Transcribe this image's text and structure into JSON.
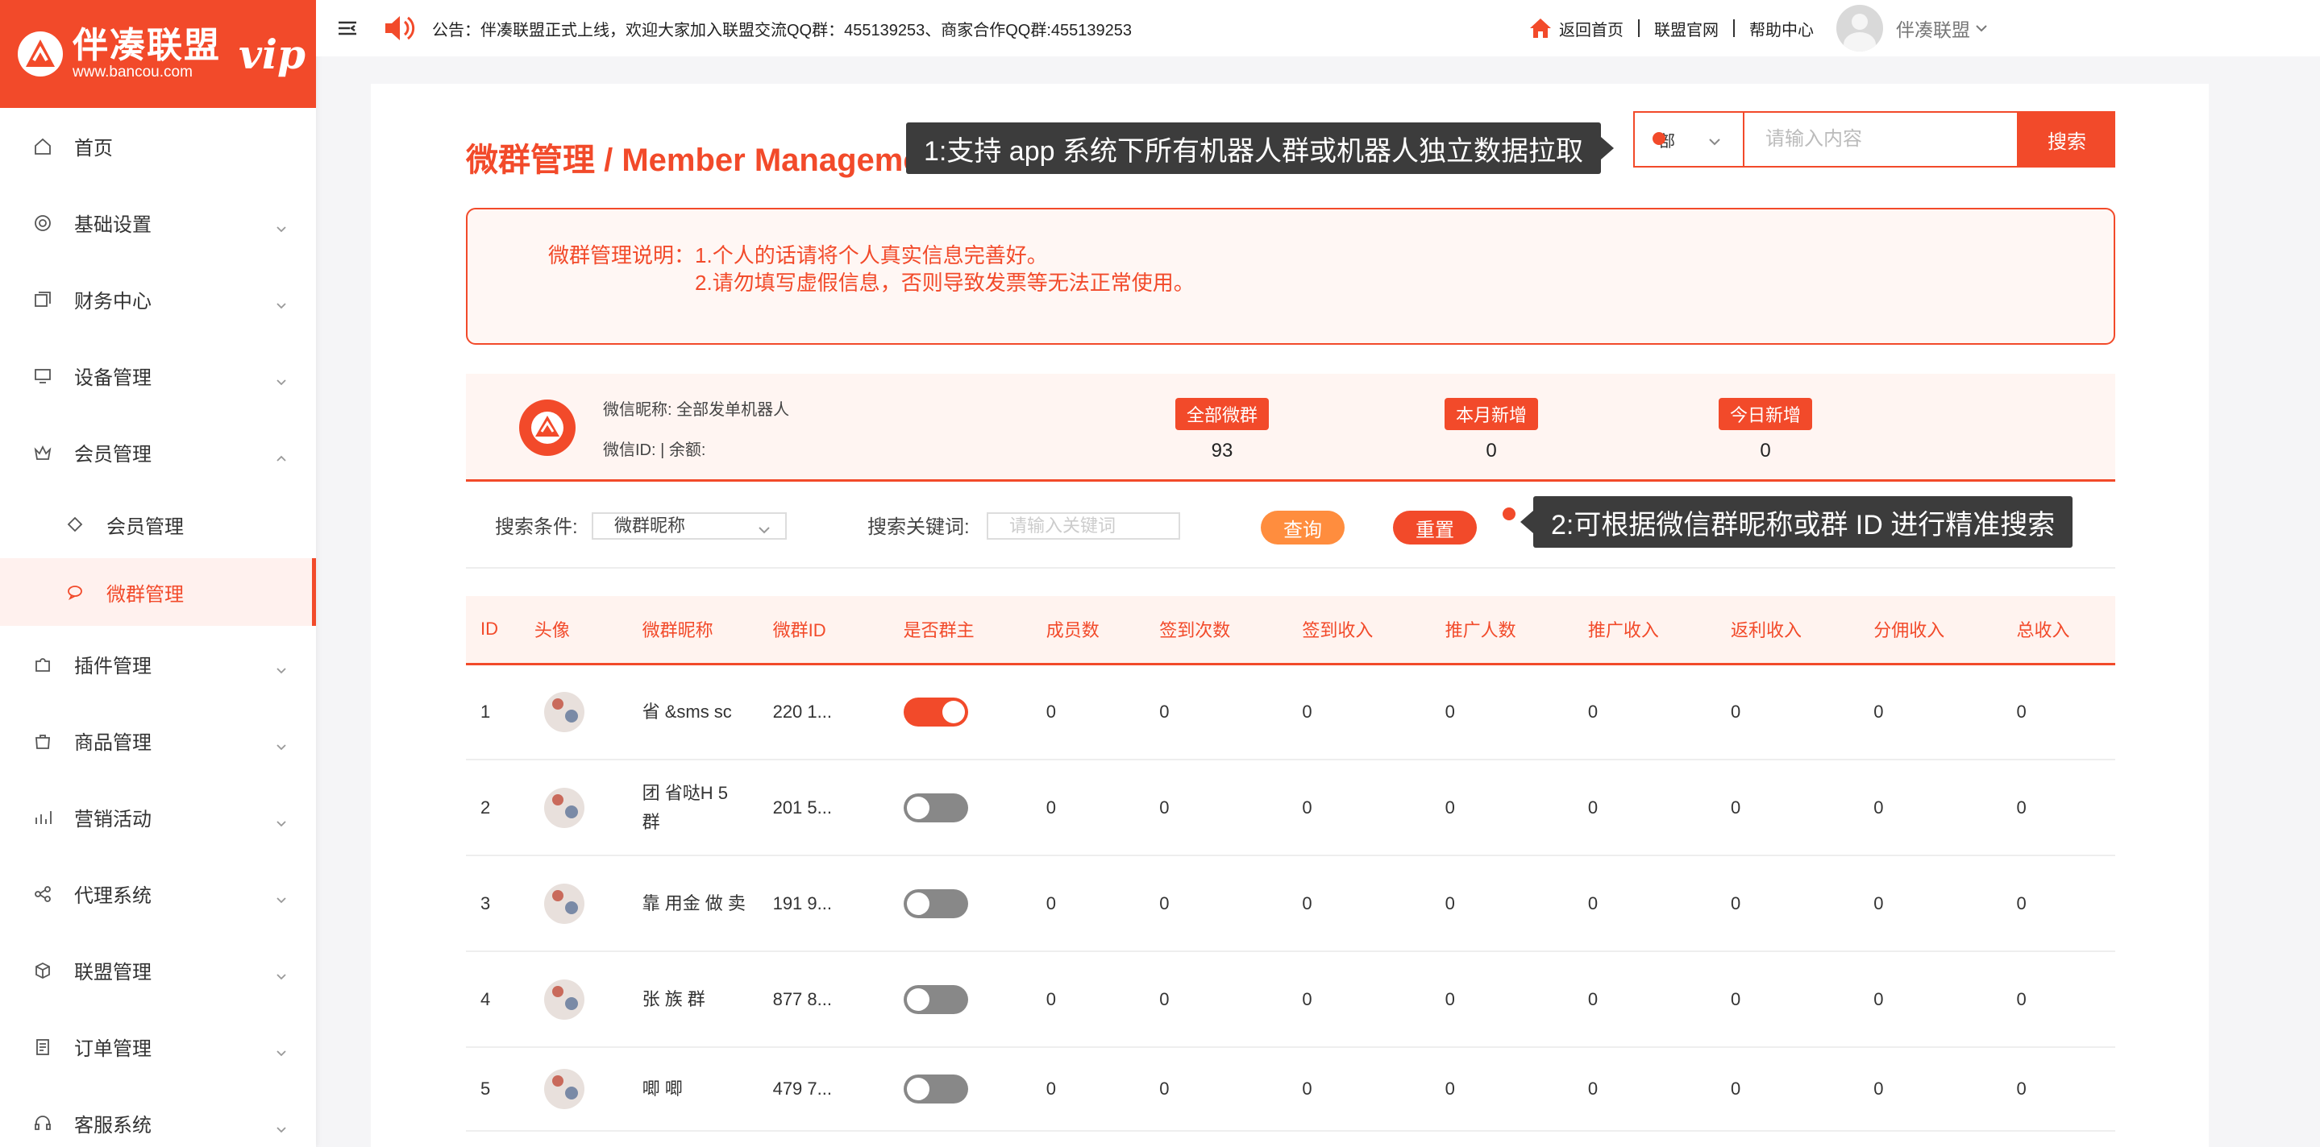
{
  "brand": {
    "name": "伴凑联盟",
    "url": "www.bancou.com",
    "vip": "vip",
    "accent_color": "#f24a2a"
  },
  "sidebar": {
    "items": [
      {
        "label": "首页",
        "icon": "home-icon"
      },
      {
        "label": "基础设置",
        "icon": "settings-icon"
      },
      {
        "label": "财务中心",
        "icon": "finance-icon"
      },
      {
        "label": "设备管理",
        "icon": "monitor-icon"
      },
      {
        "label": "会员管理",
        "icon": "crown-icon"
      },
      {
        "label": "会员管理",
        "icon": "diamond-icon"
      },
      {
        "label": "微群管理",
        "icon": "chat-icon"
      },
      {
        "label": "插件管理",
        "icon": "puzzle-icon"
      },
      {
        "label": "商品管理",
        "icon": "bag-icon"
      },
      {
        "label": "营销活动",
        "icon": "chart-icon"
      },
      {
        "label": "代理系统",
        "icon": "share-icon"
      },
      {
        "label": "联盟管理",
        "icon": "cube-icon"
      },
      {
        "label": "订单管理",
        "icon": "document-icon"
      },
      {
        "label": "客服系统",
        "icon": "headset-icon"
      }
    ]
  },
  "topbar": {
    "notice": "公告：伴凑联盟正式上线，欢迎大家加入联盟交流QQ群：455139253、商家合作QQ群:455139253",
    "links": [
      "返回首页",
      "联盟官网",
      "帮助中心"
    ],
    "user": "伴凑联盟"
  },
  "page": {
    "title": "微群管理 / Member Management",
    "search": {
      "scope": "部",
      "placeholder": "请输入内容",
      "button": "搜索"
    },
    "tip1": "1:支持 app 系统下所有机器人群或机器人独立数据拉取",
    "tip2": "2:可根据微信群昵称或群 ID 进行精准搜索",
    "desc": {
      "label": "微群管理说明：",
      "line1": "1.个人的话请将个人真实信息完善好。",
      "line2": "2.请勿填写虚假信息，否则导致发票等无法正常使用。"
    },
    "stats": {
      "nick": "微信昵称: 全部发单机器人",
      "wxid": "微信ID:    |  余额:",
      "all_label": "全部微群",
      "all_value": "93",
      "month_label": "本月新增",
      "month_value": "0",
      "today_label": "今日新增",
      "today_value": "0"
    },
    "filter": {
      "cond_label": "搜索条件:",
      "cond_value": "微群昵称",
      "kw_label": "搜索关键词:",
      "kw_placeholder": "请输入关键词",
      "query": "查询",
      "reset": "重置"
    }
  },
  "table": {
    "headers": [
      "ID",
      "头像",
      "微群昵称",
      "微群ID",
      "是否群主",
      "成员数",
      "签到次数",
      "签到收入",
      "推广人数",
      "推广收入",
      "返利收入",
      "分佣收入",
      "总收入"
    ],
    "rows": [
      {
        "id": "1",
        "nick": "省   &sms sc",
        "gid": "220    1...",
        "owner": true,
        "vals": [
          "0",
          "0",
          "0",
          "0",
          "0",
          "0",
          "0",
          "0"
        ]
      },
      {
        "id": "2",
        "nick": "团   省哒H 5     群",
        "gid": "201    5...",
        "owner": false,
        "vals": [
          "0",
          "0",
          "0",
          "0",
          "0",
          "0",
          "0",
          "0"
        ]
      },
      {
        "id": "3",
        "nick": "靠   用金 做   卖",
        "gid": "191    9...",
        "owner": false,
        "vals": [
          "0",
          "0",
          "0",
          "0",
          "0",
          "0",
          "0",
          "0"
        ]
      },
      {
        "id": "4",
        "nick": "张   族 群",
        "gid": "877    8...",
        "owner": false,
        "vals": [
          "0",
          "0",
          "0",
          "0",
          "0",
          "0",
          "0",
          "0"
        ]
      },
      {
        "id": "5",
        "nick": "唧     唧",
        "gid": "479    7...",
        "owner": false,
        "vals": [
          "0",
          "0",
          "0",
          "0",
          "0",
          "0",
          "0",
          "0"
        ]
      }
    ]
  }
}
